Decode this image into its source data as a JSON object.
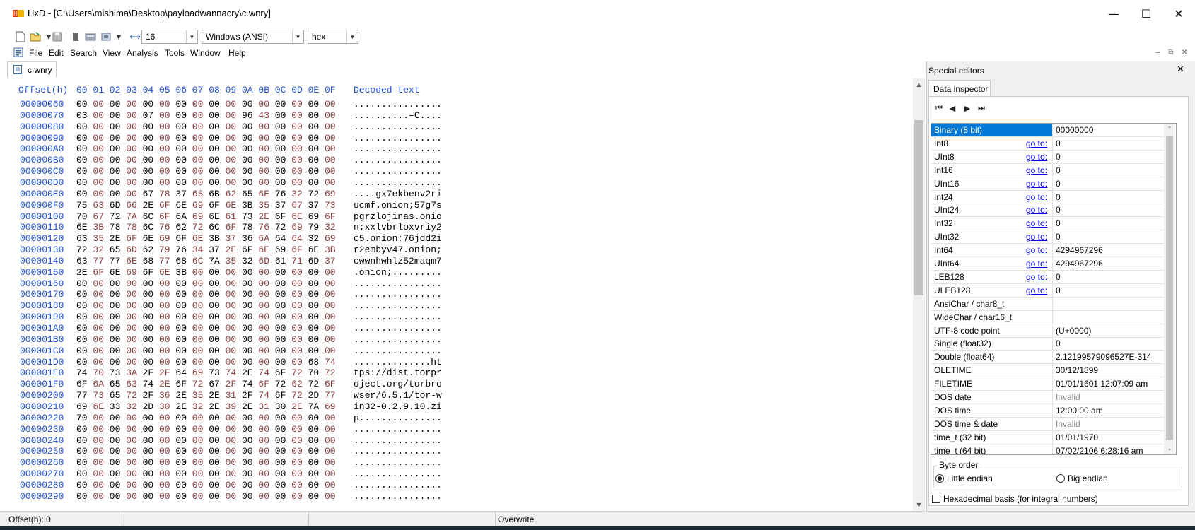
{
  "window": {
    "title": "HxD - [C:\\Users\\mishima\\Desktop\\payloadwannacry\\c.wnry]"
  },
  "toolbar": {
    "bytes_per_row": "16",
    "charset": "Windows (ANSI)",
    "display_mode": "hex",
    "icons": [
      "new-file-icon",
      "open-file-icon",
      "save-icon",
      "file-tools-icon",
      "disk-icon",
      "ram-icon",
      "columns-icon"
    ]
  },
  "menu": [
    "File",
    "Edit",
    "Search",
    "View",
    "Analysis",
    "Tools",
    "Window",
    "Help"
  ],
  "document_tab": "c.wnry",
  "hex_header": {
    "offset_label": "Offset(h)",
    "columns": [
      "00",
      "01",
      "02",
      "03",
      "04",
      "05",
      "06",
      "07",
      "08",
      "09",
      "0A",
      "0B",
      "0C",
      "0D",
      "0E",
      "0F"
    ],
    "decoded_label": "Decoded text"
  },
  "rows": [
    {
      "offset": "00000060",
      "bytes": [
        "00",
        "00",
        "00",
        "00",
        "00",
        "00",
        "00",
        "00",
        "00",
        "00",
        "00",
        "00",
        "00",
        "00",
        "00",
        "00"
      ],
      "text": "................"
    },
    {
      "offset": "00000070",
      "bytes": [
        "03",
        "00",
        "00",
        "00",
        "07",
        "00",
        "00",
        "00",
        "00",
        "00",
        "96",
        "43",
        "00",
        "00",
        "00",
        "00"
      ],
      "text": "..........–C...."
    },
    {
      "offset": "00000080",
      "bytes": [
        "00",
        "00",
        "00",
        "00",
        "00",
        "00",
        "00",
        "00",
        "00",
        "00",
        "00",
        "00",
        "00",
        "00",
        "00",
        "00"
      ],
      "text": "................"
    },
    {
      "offset": "00000090",
      "bytes": [
        "00",
        "00",
        "00",
        "00",
        "00",
        "00",
        "00",
        "00",
        "00",
        "00",
        "00",
        "00",
        "00",
        "00",
        "00",
        "00"
      ],
      "text": "................"
    },
    {
      "offset": "000000A0",
      "bytes": [
        "00",
        "00",
        "00",
        "00",
        "00",
        "00",
        "00",
        "00",
        "00",
        "00",
        "00",
        "00",
        "00",
        "00",
        "00",
        "00"
      ],
      "text": "................"
    },
    {
      "offset": "000000B0",
      "bytes": [
        "00",
        "00",
        "00",
        "00",
        "00",
        "00",
        "00",
        "00",
        "00",
        "00",
        "00",
        "00",
        "00",
        "00",
        "00",
        "00"
      ],
      "text": "................"
    },
    {
      "offset": "000000C0",
      "bytes": [
        "00",
        "00",
        "00",
        "00",
        "00",
        "00",
        "00",
        "00",
        "00",
        "00",
        "00",
        "00",
        "00",
        "00",
        "00",
        "00"
      ],
      "text": "................"
    },
    {
      "offset": "000000D0",
      "bytes": [
        "00",
        "00",
        "00",
        "00",
        "00",
        "00",
        "00",
        "00",
        "00",
        "00",
        "00",
        "00",
        "00",
        "00",
        "00",
        "00"
      ],
      "text": "................"
    },
    {
      "offset": "000000E0",
      "bytes": [
        "00",
        "00",
        "00",
        "00",
        "67",
        "78",
        "37",
        "65",
        "6B",
        "62",
        "65",
        "6E",
        "76",
        "32",
        "72",
        "69"
      ],
      "text": "....gx7ekbenv2ri"
    },
    {
      "offset": "000000F0",
      "bytes": [
        "75",
        "63",
        "6D",
        "66",
        "2E",
        "6F",
        "6E",
        "69",
        "6F",
        "6E",
        "3B",
        "35",
        "37",
        "67",
        "37",
        "73"
      ],
      "text": "ucmf.onion;57g7s"
    },
    {
      "offset": "00000100",
      "bytes": [
        "70",
        "67",
        "72",
        "7A",
        "6C",
        "6F",
        "6A",
        "69",
        "6E",
        "61",
        "73",
        "2E",
        "6F",
        "6E",
        "69",
        "6F"
      ],
      "text": "pgrzlojinas.onio"
    },
    {
      "offset": "00000110",
      "bytes": [
        "6E",
        "3B",
        "78",
        "78",
        "6C",
        "76",
        "62",
        "72",
        "6C",
        "6F",
        "78",
        "76",
        "72",
        "69",
        "79",
        "32"
      ],
      "text": "n;xxlvbrloxvriy2"
    },
    {
      "offset": "00000120",
      "bytes": [
        "63",
        "35",
        "2E",
        "6F",
        "6E",
        "69",
        "6F",
        "6E",
        "3B",
        "37",
        "36",
        "6A",
        "64",
        "64",
        "32",
        "69"
      ],
      "text": "c5.onion;76jdd2i"
    },
    {
      "offset": "00000130",
      "bytes": [
        "72",
        "32",
        "65",
        "6D",
        "62",
        "79",
        "76",
        "34",
        "37",
        "2E",
        "6F",
        "6E",
        "69",
        "6F",
        "6E",
        "3B"
      ],
      "text": "r2embyv47.onion;"
    },
    {
      "offset": "00000140",
      "bytes": [
        "63",
        "77",
        "77",
        "6E",
        "68",
        "77",
        "68",
        "6C",
        "7A",
        "35",
        "32",
        "6D",
        "61",
        "71",
        "6D",
        "37"
      ],
      "text": "cwwnhwhlz52maqm7"
    },
    {
      "offset": "00000150",
      "bytes": [
        "2E",
        "6F",
        "6E",
        "69",
        "6F",
        "6E",
        "3B",
        "00",
        "00",
        "00",
        "00",
        "00",
        "00",
        "00",
        "00",
        "00"
      ],
      "text": ".onion;........."
    },
    {
      "offset": "00000160",
      "bytes": [
        "00",
        "00",
        "00",
        "00",
        "00",
        "00",
        "00",
        "00",
        "00",
        "00",
        "00",
        "00",
        "00",
        "00",
        "00",
        "00"
      ],
      "text": "................"
    },
    {
      "offset": "00000170",
      "bytes": [
        "00",
        "00",
        "00",
        "00",
        "00",
        "00",
        "00",
        "00",
        "00",
        "00",
        "00",
        "00",
        "00",
        "00",
        "00",
        "00"
      ],
      "text": "................"
    },
    {
      "offset": "00000180",
      "bytes": [
        "00",
        "00",
        "00",
        "00",
        "00",
        "00",
        "00",
        "00",
        "00",
        "00",
        "00",
        "00",
        "00",
        "00",
        "00",
        "00"
      ],
      "text": "................"
    },
    {
      "offset": "00000190",
      "bytes": [
        "00",
        "00",
        "00",
        "00",
        "00",
        "00",
        "00",
        "00",
        "00",
        "00",
        "00",
        "00",
        "00",
        "00",
        "00",
        "00"
      ],
      "text": "................"
    },
    {
      "offset": "000001A0",
      "bytes": [
        "00",
        "00",
        "00",
        "00",
        "00",
        "00",
        "00",
        "00",
        "00",
        "00",
        "00",
        "00",
        "00",
        "00",
        "00",
        "00"
      ],
      "text": "................"
    },
    {
      "offset": "000001B0",
      "bytes": [
        "00",
        "00",
        "00",
        "00",
        "00",
        "00",
        "00",
        "00",
        "00",
        "00",
        "00",
        "00",
        "00",
        "00",
        "00",
        "00"
      ],
      "text": "................"
    },
    {
      "offset": "000001C0",
      "bytes": [
        "00",
        "00",
        "00",
        "00",
        "00",
        "00",
        "00",
        "00",
        "00",
        "00",
        "00",
        "00",
        "00",
        "00",
        "00",
        "00"
      ],
      "text": "................"
    },
    {
      "offset": "000001D0",
      "bytes": [
        "00",
        "00",
        "00",
        "00",
        "00",
        "00",
        "00",
        "00",
        "00",
        "00",
        "00",
        "00",
        "00",
        "00",
        "68",
        "74"
      ],
      "text": "..............ht"
    },
    {
      "offset": "000001E0",
      "bytes": [
        "74",
        "70",
        "73",
        "3A",
        "2F",
        "2F",
        "64",
        "69",
        "73",
        "74",
        "2E",
        "74",
        "6F",
        "72",
        "70",
        "72"
      ],
      "text": "tps://dist.torpr"
    },
    {
      "offset": "000001F0",
      "bytes": [
        "6F",
        "6A",
        "65",
        "63",
        "74",
        "2E",
        "6F",
        "72",
        "67",
        "2F",
        "74",
        "6F",
        "72",
        "62",
        "72",
        "6F"
      ],
      "text": "oject.org/torbro"
    },
    {
      "offset": "00000200",
      "bytes": [
        "77",
        "73",
        "65",
        "72",
        "2F",
        "36",
        "2E",
        "35",
        "2E",
        "31",
        "2F",
        "74",
        "6F",
        "72",
        "2D",
        "77"
      ],
      "text": "wser/6.5.1/tor-w"
    },
    {
      "offset": "00000210",
      "bytes": [
        "69",
        "6E",
        "33",
        "32",
        "2D",
        "30",
        "2E",
        "32",
        "2E",
        "39",
        "2E",
        "31",
        "30",
        "2E",
        "7A",
        "69"
      ],
      "text": "in32-0.2.9.10.zi"
    },
    {
      "offset": "00000220",
      "bytes": [
        "70",
        "00",
        "00",
        "00",
        "00",
        "00",
        "00",
        "00",
        "00",
        "00",
        "00",
        "00",
        "00",
        "00",
        "00",
        "00"
      ],
      "text": "p..............."
    },
    {
      "offset": "00000230",
      "bytes": [
        "00",
        "00",
        "00",
        "00",
        "00",
        "00",
        "00",
        "00",
        "00",
        "00",
        "00",
        "00",
        "00",
        "00",
        "00",
        "00"
      ],
      "text": "................"
    },
    {
      "offset": "00000240",
      "bytes": [
        "00",
        "00",
        "00",
        "00",
        "00",
        "00",
        "00",
        "00",
        "00",
        "00",
        "00",
        "00",
        "00",
        "00",
        "00",
        "00"
      ],
      "text": "................"
    },
    {
      "offset": "00000250",
      "bytes": [
        "00",
        "00",
        "00",
        "00",
        "00",
        "00",
        "00",
        "00",
        "00",
        "00",
        "00",
        "00",
        "00",
        "00",
        "00",
        "00"
      ],
      "text": "................"
    },
    {
      "offset": "00000260",
      "bytes": [
        "00",
        "00",
        "00",
        "00",
        "00",
        "00",
        "00",
        "00",
        "00",
        "00",
        "00",
        "00",
        "00",
        "00",
        "00",
        "00"
      ],
      "text": "................"
    },
    {
      "offset": "00000270",
      "bytes": [
        "00",
        "00",
        "00",
        "00",
        "00",
        "00",
        "00",
        "00",
        "00",
        "00",
        "00",
        "00",
        "00",
        "00",
        "00",
        "00"
      ],
      "text": "................"
    },
    {
      "offset": "00000280",
      "bytes": [
        "00",
        "00",
        "00",
        "00",
        "00",
        "00",
        "00",
        "00",
        "00",
        "00",
        "00",
        "00",
        "00",
        "00",
        "00",
        "00"
      ],
      "text": "................"
    },
    {
      "offset": "00000290",
      "bytes": [
        "00",
        "00",
        "00",
        "00",
        "00",
        "00",
        "00",
        "00",
        "00",
        "00",
        "00",
        "00",
        "00",
        "00",
        "00",
        "00"
      ],
      "text": "................"
    }
  ],
  "special_editors": {
    "title": "Special editors",
    "tab": "Data inspector",
    "goto_label": "go to:",
    "fields": [
      {
        "name": "Binary (8 bit)",
        "value": "00000000",
        "goto": false,
        "selected": true
      },
      {
        "name": "Int8",
        "value": "0",
        "goto": true
      },
      {
        "name": "UInt8",
        "value": "0",
        "goto": true
      },
      {
        "name": "Int16",
        "value": "0",
        "goto": true
      },
      {
        "name": "UInt16",
        "value": "0",
        "goto": true
      },
      {
        "name": "Int24",
        "value": "0",
        "goto": true
      },
      {
        "name": "UInt24",
        "value": "0",
        "goto": true
      },
      {
        "name": "Int32",
        "value": "0",
        "goto": true
      },
      {
        "name": "UInt32",
        "value": "0",
        "goto": true
      },
      {
        "name": "Int64",
        "value": "4294967296",
        "goto": true
      },
      {
        "name": "UInt64",
        "value": "4294967296",
        "goto": true
      },
      {
        "name": "LEB128",
        "value": "0",
        "goto": true
      },
      {
        "name": "ULEB128",
        "value": "0",
        "goto": true
      },
      {
        "name": "AnsiChar / char8_t",
        "value": "",
        "goto": false
      },
      {
        "name": "WideChar / char16_t",
        "value": "",
        "goto": false
      },
      {
        "name": "UTF-8 code point",
        "value": " (U+0000)",
        "goto": false
      },
      {
        "name": "Single (float32)",
        "value": "0",
        "goto": false
      },
      {
        "name": "Double (float64)",
        "value": "2.12199579096527E-314",
        "goto": false
      },
      {
        "name": "OLETIME",
        "value": "30/12/1899",
        "goto": false
      },
      {
        "name": "FILETIME",
        "value": "01/01/1601 12:07:09 am",
        "goto": false
      },
      {
        "name": "DOS date",
        "value": "Invalid",
        "goto": false,
        "gray": true
      },
      {
        "name": "DOS time",
        "value": "12:00:00 am",
        "goto": false
      },
      {
        "name": "DOS time & date",
        "value": "Invalid",
        "goto": false,
        "gray": true
      },
      {
        "name": "time_t (32 bit)",
        "value": "01/01/1970",
        "goto": false
      },
      {
        "name": "time_t (64 bit)",
        "value": "07/02/2106 6:28:16 am",
        "goto": false
      }
    ],
    "byte_order_label": "Byte order",
    "little_endian": "Little endian",
    "big_endian": "Big endian",
    "selected_byte_order": "little",
    "hex_basis_label": "Hexadecimal basis (for integral numbers)",
    "hex_basis_checked": false
  },
  "status": {
    "offset": "Offset(h): 0",
    "mode": "Overwrite"
  }
}
